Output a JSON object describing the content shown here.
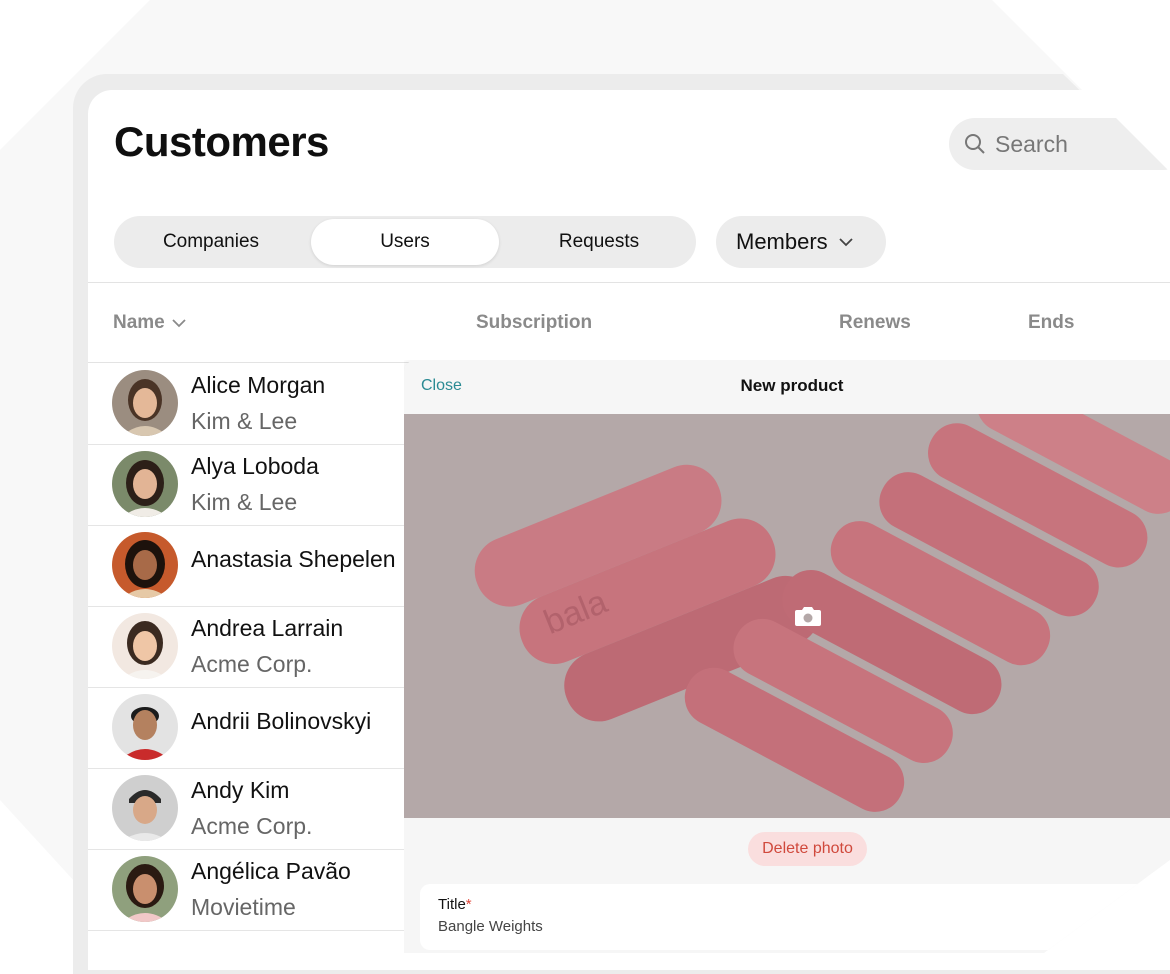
{
  "page": {
    "title": "Customers",
    "search_placeholder": "Search"
  },
  "tabs": [
    {
      "label": "Companies",
      "active": false
    },
    {
      "label": "Users",
      "active": true
    },
    {
      "label": "Requests",
      "active": false
    }
  ],
  "filter": {
    "label": "Members"
  },
  "table": {
    "columns": [
      "Name",
      "Subscription",
      "Renews",
      "Ends"
    ],
    "rows": [
      {
        "name": "Alice Morgan",
        "company": "Kim & Lee"
      },
      {
        "name": "Alya Loboda",
        "company": "Kim & Lee"
      },
      {
        "name": "Anastasia Shepelen",
        "company": ""
      },
      {
        "name": "Andrea Larrain",
        "company": "Acme Corp."
      },
      {
        "name": "Andrii Bolinovskyi",
        "company": ""
      },
      {
        "name": "Andy Kim",
        "company": "Acme Corp."
      },
      {
        "name": "Angélica Pavão",
        "company": "Movietime"
      }
    ]
  },
  "sheet": {
    "close_label": "Close",
    "title": "New product",
    "delete_photo_label": "Delete photo",
    "field": {
      "label": "Title",
      "required_mark": "*",
      "value": "Bangle Weights"
    },
    "photo_brand": "bala"
  },
  "colors": {
    "accent": "#2a8a93",
    "danger": "#d0493c",
    "photo_bg": "#b4a8a8",
    "product": "#c7747d"
  }
}
